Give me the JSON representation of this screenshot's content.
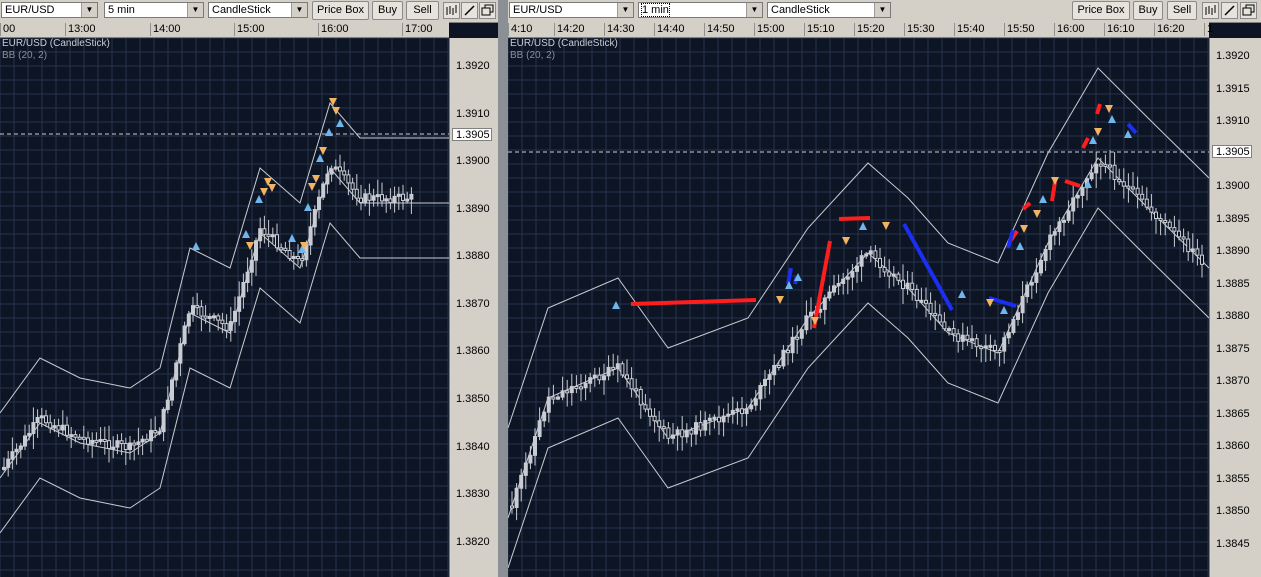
{
  "left": {
    "symbol": "EUR/USD",
    "interval": "5 min",
    "chart_type": "CandleStick",
    "price_box_label": "Price Box",
    "buy_label": "Buy",
    "sell_label": "Sell",
    "title": "EUR/USD (CandleStick)",
    "indicator": "BB (20, 2)",
    "time_labels": [
      "00",
      "13:00",
      "14:00",
      "15:00",
      "16:00",
      "17:00"
    ],
    "price_labels": [
      "1.3920",
      "1.3910",
      "1.3900",
      "1.3890",
      "1.3880",
      "1.3870",
      "1.3860",
      "1.3850",
      "1.3840",
      "1.3830",
      "1.3820"
    ],
    "current_price": "1.3905"
  },
  "right": {
    "symbol": "EUR/USD",
    "interval": "1 min",
    "chart_type": "CandleStick",
    "price_box_label": "Price Box",
    "buy_label": "Buy",
    "sell_label": "Sell",
    "title": "EUR/USD (CandleStick)",
    "indicator": "BB (20, 2)",
    "time_labels": [
      "4:10",
      "14:20",
      "14:30",
      "14:40",
      "14:50",
      "15:00",
      "15:10",
      "15:20",
      "15:30",
      "15:40",
      "15:50",
      "16:00",
      "16:10",
      "16:20",
      "1"
    ],
    "price_labels": [
      "1.3920",
      "1.3915",
      "1.3910",
      "1.3905",
      "1.3900",
      "1.3895",
      "1.3890",
      "1.3885",
      "1.3880",
      "1.3875",
      "1.3870",
      "1.3865",
      "1.3860",
      "1.3855",
      "1.3850",
      "1.3845"
    ],
    "current_price": "1.3905"
  },
  "colors": {
    "background": "#0d1525",
    "grid": "#26324a",
    "candle": "#c9ccd2",
    "band": "#c9ccd2",
    "up_arrow": "#6fb6ee",
    "down_arrow": "#f2b463",
    "red_line": "#ff1e1e",
    "blue_line": "#1c2ef2"
  }
}
